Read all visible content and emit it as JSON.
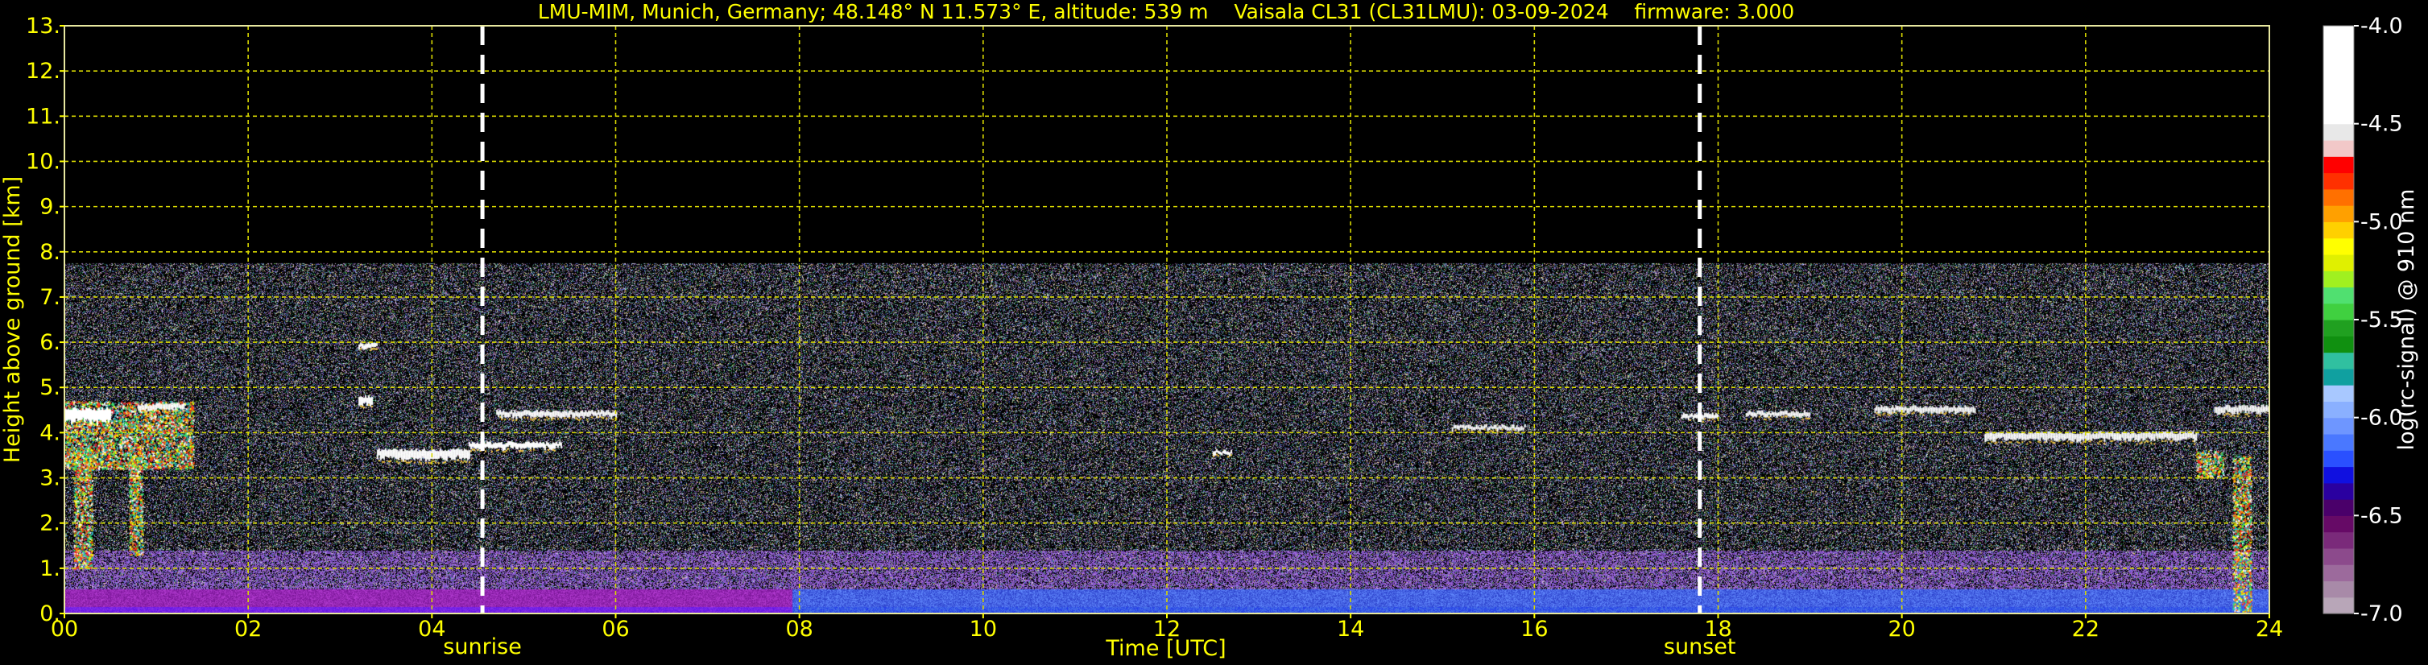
{
  "chart_data": {
    "type": "heatmap",
    "title": "LMU-MIM, Munich, Germany; 48.148° N 11.573° E, altitude: 539 m    Vaisala CL31 (CL31LMU): 03-09-2024    firmware: 3.000",
    "xlabel": "Time [UTC]",
    "ylabel": "Height above ground [km]",
    "xlim": [
      0,
      24
    ],
    "ylim": [
      0,
      13
    ],
    "x_ticks": [
      "00",
      "02",
      "04",
      "06",
      "08",
      "10",
      "12",
      "14",
      "16",
      "18",
      "20",
      "22",
      "24"
    ],
    "y_ticks": [
      "0.",
      "1.",
      "2.",
      "3.",
      "4.",
      "5.",
      "6.",
      "7.",
      "8.",
      "9.",
      "10.",
      "11.",
      "12.",
      "13."
    ],
    "grid": true,
    "markers": [
      {
        "label": "sunrise",
        "x": 4.55
      },
      {
        "label": "sunset",
        "x": 17.8
      }
    ],
    "signal_top_km": 7.75,
    "colorbar": {
      "label": "log(rc-signal) @ 910 nm",
      "ticks": [
        "-4.0",
        "-4.5",
        "-5.0",
        "-5.5",
        "-6.0",
        "-6.5",
        "-7.0"
      ],
      "range": [
        -7.0,
        -4.0
      ],
      "colors": [
        "#b8a6b8",
        "#a88aa8",
        "#9c6a9c",
        "#8c4a8c",
        "#7a2a7a",
        "#660a66",
        "#4a006a",
        "#2a00a0",
        "#1010e0",
        "#2a50ff",
        "#4a78ff",
        "#6e96ff",
        "#8ab0ff",
        "#a8c8ff",
        "#10a0a0",
        "#30c0a0",
        "#109010",
        "#20a020",
        "#40d040",
        "#50e070",
        "#a0f020",
        "#e0f000",
        "#ffff00",
        "#ffd000",
        "#ffa000",
        "#ff7000",
        "#ff3000",
        "#ff0000",
        "#f2c8c8",
        "#e8e8e8",
        "#ffffff",
        "#ffffff",
        "#ffffff",
        "#ffffff",
        "#ffffff",
        "#ffffff"
      ]
    },
    "cloud_layers": [
      {
        "x0": 0.0,
        "x1": 0.5,
        "y": 4.35,
        "h": 0.35
      },
      {
        "x0": 0.8,
        "x1": 1.3,
        "y": 4.55,
        "h": 0.15
      },
      {
        "x0": 3.2,
        "x1": 3.4,
        "y": 5.9,
        "h": 0.12
      },
      {
        "x0": 3.2,
        "x1": 3.35,
        "y": 4.7,
        "h": 0.2
      },
      {
        "x0": 3.4,
        "x1": 4.4,
        "y": 3.5,
        "h": 0.25
      },
      {
        "x0": 4.4,
        "x1": 5.4,
        "y": 3.7,
        "h": 0.15
      },
      {
        "x0": 4.7,
        "x1": 6.0,
        "y": 4.4,
        "h": 0.15
      },
      {
        "x0": 12.5,
        "x1": 12.7,
        "y": 3.55,
        "h": 0.1
      },
      {
        "x0": 15.1,
        "x1": 15.9,
        "y": 4.1,
        "h": 0.1
      },
      {
        "x0": 17.6,
        "x1": 18.0,
        "y": 4.35,
        "h": 0.12
      },
      {
        "x0": 18.3,
        "x1": 19.0,
        "y": 4.4,
        "h": 0.12
      },
      {
        "x0": 19.7,
        "x1": 20.8,
        "y": 4.5,
        "h": 0.15
      },
      {
        "x0": 20.9,
        "x1": 23.2,
        "y": 3.9,
        "h": 0.2
      },
      {
        "x0": 23.4,
        "x1": 24.0,
        "y": 4.5,
        "h": 0.18
      }
    ],
    "color_clusters": [
      {
        "x0": 0.0,
        "x1": 1.4,
        "y0": 3.2,
        "y1": 4.7
      },
      {
        "x0": 0.1,
        "x1": 0.3,
        "y0": 1.0,
        "y1": 3.6
      },
      {
        "x0": 0.7,
        "x1": 0.85,
        "y0": 1.3,
        "y1": 3.5
      },
      {
        "x0": 23.6,
        "x1": 23.8,
        "y0": 0.0,
        "y1": 3.5
      },
      {
        "x0": 23.2,
        "x1": 23.5,
        "y0": 3.0,
        "y1": 3.6
      }
    ]
  }
}
